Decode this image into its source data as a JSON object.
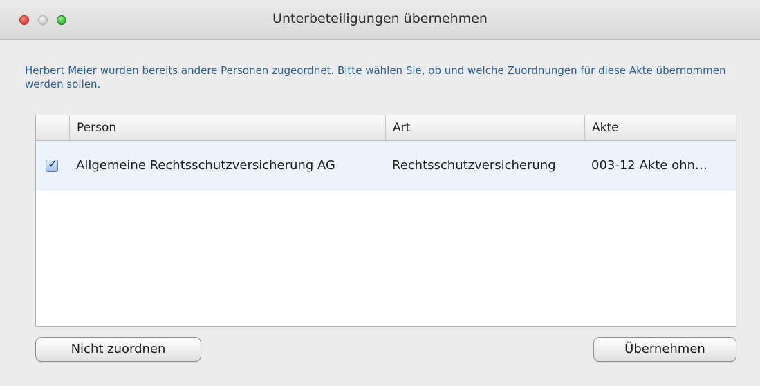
{
  "window": {
    "title": "Unterbeteiligungen übernehmen"
  },
  "message": "Herbert Meier wurden bereits andere Personen zugeordnet. Bitte wählen Sie, ob und welche Zuordnungen für diese Akte übernommen werden sollen.",
  "table": {
    "columns": [
      "",
      "Person",
      "Art",
      "Akte"
    ],
    "rows": [
      {
        "checked": true,
        "person": "Allgemeine Rechtsschutzversicherung AG",
        "art": "Rechtsschutzversicherung",
        "akte": "003-12 Akte ohn…"
      }
    ]
  },
  "buttons": {
    "left": "Nicht zuordnen",
    "right": "Übernehmen"
  }
}
